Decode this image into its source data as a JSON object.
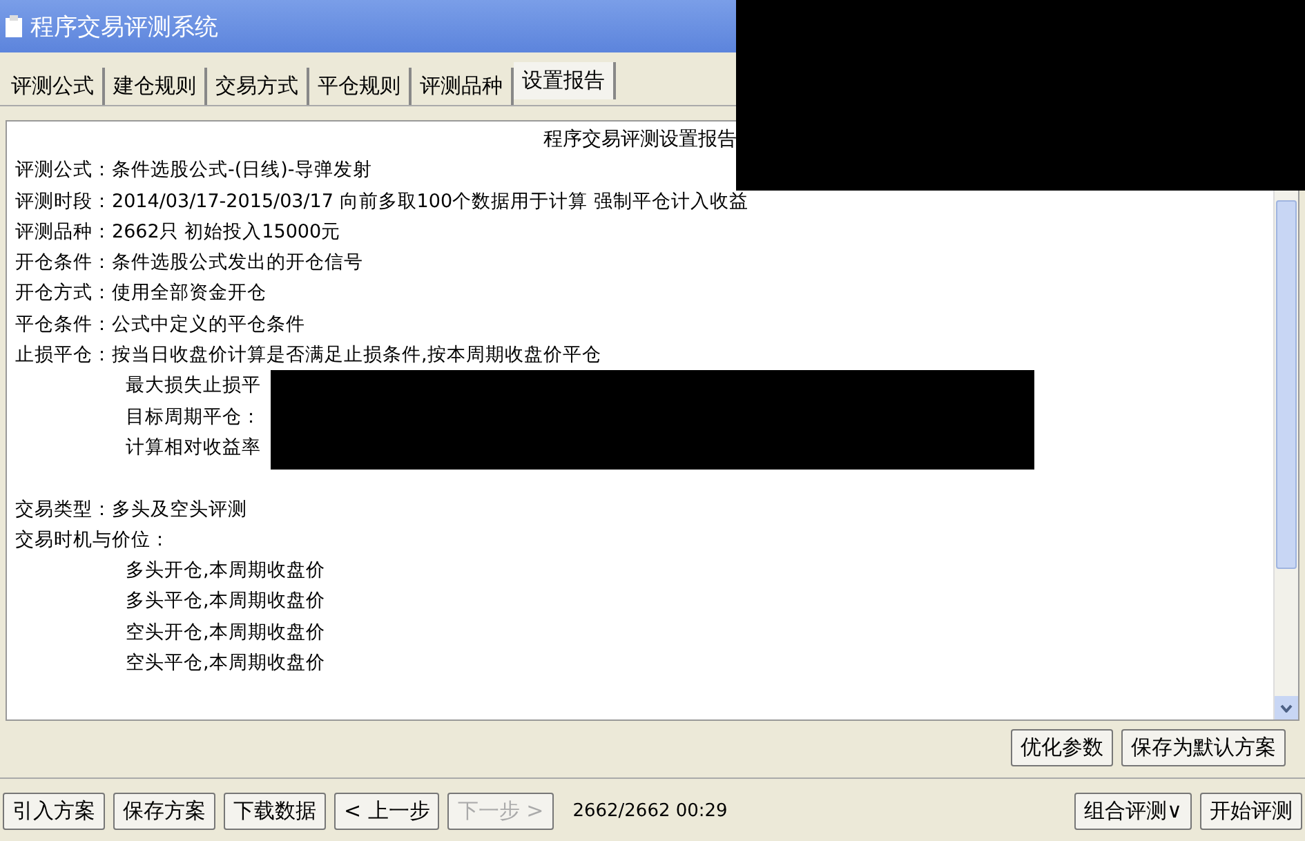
{
  "window": {
    "title": "程序交易评测系统"
  },
  "tabs": [
    {
      "label": "评测公式",
      "selected": false
    },
    {
      "label": "建仓规则",
      "selected": false
    },
    {
      "label": "交易方式",
      "selected": false
    },
    {
      "label": "平仓规则",
      "selected": false
    },
    {
      "label": "评测品种",
      "selected": false
    },
    {
      "label": "设置报告",
      "selected": true
    }
  ],
  "report": {
    "title": "程序交易评测设置报告",
    "lines": [
      {
        "label": "评测公式：",
        "text": "条件选股公式-(日线)-导弹发射"
      },
      {
        "label": "评测时段：",
        "text": "2014/03/17-2015/03/17 向前多取100个数据用于计算 强制平仓计入收益"
      },
      {
        "label": "评测品种：",
        "text": "2662只 初始投入15000元"
      },
      {
        "label": "开仓条件：",
        "text": "条件选股公式发出的开仓信号"
      },
      {
        "label": "开仓方式：",
        "text": "使用全部资金开仓"
      },
      {
        "label": "平仓条件：",
        "text": "公式中定义的平仓条件"
      },
      {
        "label": "止损平仓：",
        "text": "按当日收盘价计算是否满足止损条件,按本周期收盘价平仓"
      },
      {
        "text": "最大损失止损平"
      },
      {
        "text": "目标周期平仓："
      },
      {
        "text": "计算相对收益率"
      }
    ],
    "trade_lines": [
      {
        "label": "交易类型：",
        "text": "多头及空头评测"
      },
      {
        "label": "交易时机与价位："
      },
      {
        "text": "多头开仓,本周期收盘价"
      },
      {
        "text": "多头平仓,本周期收盘价"
      },
      {
        "text": "空头开仓,本周期收盘价"
      },
      {
        "text": "空头平仓,本周期收盘价"
      }
    ]
  },
  "action_buttons": [
    {
      "label": "优化参数"
    },
    {
      "label": "保存为默认方案"
    }
  ],
  "toolbar": [
    {
      "label": "引入方案",
      "disabled": false
    },
    {
      "label": "保存方案",
      "disabled": false
    },
    {
      "label": "下载数据",
      "disabled": false
    },
    {
      "label": "< 上一步",
      "disabled": false
    },
    {
      "label": "下一步 >",
      "disabled": true
    }
  ],
  "status": "2662/2662 00:29",
  "right_buttons": [
    {
      "label": "组合评测∨"
    },
    {
      "label": "开始评测"
    }
  ]
}
